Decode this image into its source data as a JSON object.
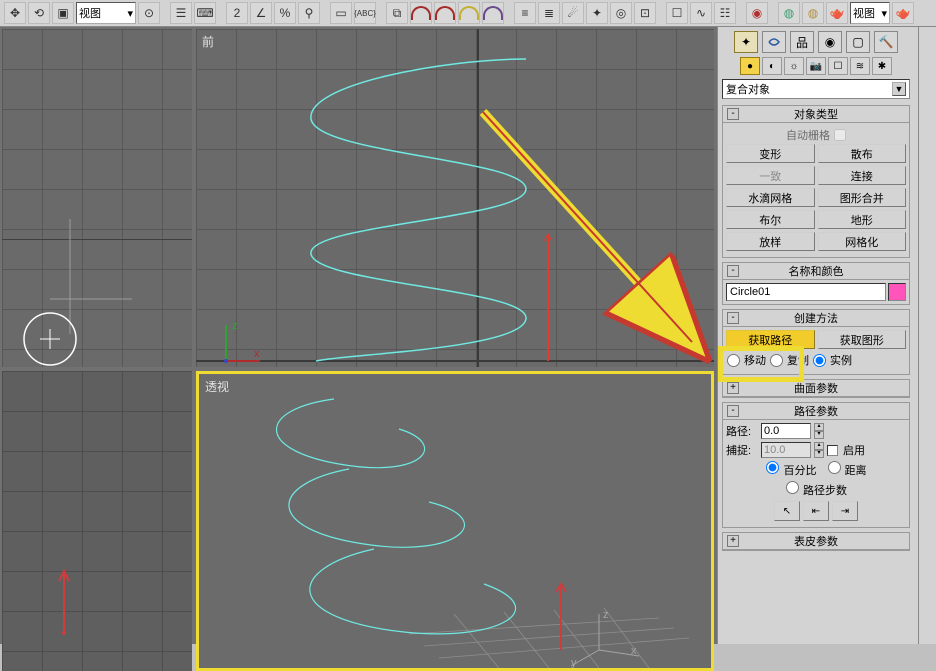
{
  "toolbar_view_label": "视图",
  "viewports": {
    "front_label": "前",
    "persp_label": "透视"
  },
  "command_panel": {
    "category": "复合对象",
    "object_type_header": "对象类型",
    "auto_grid_label": "自动栅格",
    "types": [
      [
        "变形",
        "散布"
      ],
      [
        "一致",
        "连接"
      ],
      [
        "水滴网格",
        "图形合并"
      ],
      [
        "布尔",
        "地形"
      ],
      [
        "放样",
        "网格化"
      ]
    ],
    "name_color_header": "名称和颜色",
    "object_name": "Circle01",
    "create_method_header": "创建方法",
    "get_path_label": "获取路径",
    "get_shape_label": "获取图形",
    "move_label": "移动",
    "copy_label": "复制",
    "instance_label": "实例",
    "curve_params_header": "曲面参数",
    "path_params_header": "路径参数",
    "path_label": "路径:",
    "path_value": "0.0",
    "snap_label": "捕捉:",
    "snap_value": "10.0",
    "enable_label": "启用",
    "percent_label": "百分比",
    "distance_label": "距离",
    "path_steps_label": "路径步数",
    "skin_params_header": "表皮参数"
  }
}
